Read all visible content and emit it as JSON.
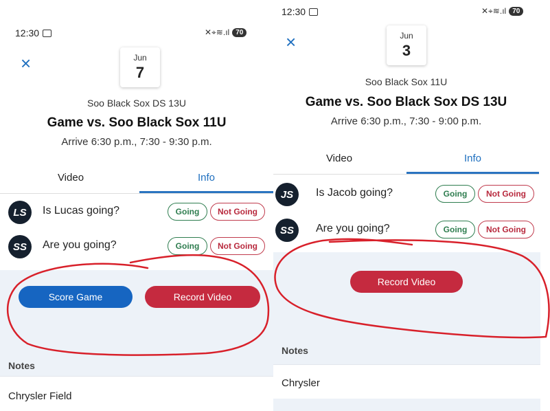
{
  "left": {
    "status": {
      "time": "12:30",
      "battery": "70",
      "icons": "✕⌖≋.ıl"
    },
    "close_glyph": "×",
    "date": {
      "month": "Jun",
      "day": "7"
    },
    "event": {
      "team": "Soo Black Sox DS 13U",
      "title": "Game vs. Soo Black Sox 11U",
      "time": "Arrive 6:30 p.m., 7:30 - 9:30 p.m."
    },
    "tabs": {
      "video": "Video",
      "info": "Info"
    },
    "rsvp": [
      {
        "initials": "LS",
        "question": "Is Lucas going?",
        "going": "Going",
        "not_going": "Not Going"
      },
      {
        "initials": "SS",
        "question": "Are you going?",
        "going": "Going",
        "not_going": "Not Going"
      }
    ],
    "buttons": {
      "score": "Score Game",
      "record": "Record Video"
    },
    "notes": {
      "label": "Notes",
      "text": "Chrysler Field"
    }
  },
  "right": {
    "status": {
      "time": "12:30",
      "battery": "70",
      "icons": "✕⌖≋.ıl"
    },
    "close_glyph": "×",
    "date": {
      "month": "Jun",
      "day": "3"
    },
    "event": {
      "team": "Soo Black Sox 11U",
      "title": "Game vs. Soo Black Sox DS 13U",
      "time": "Arrive 6:30 p.m., 7:30 - 9:00 p.m."
    },
    "tabs": {
      "video": "Video",
      "info": "Info"
    },
    "rsvp": [
      {
        "initials": "JS",
        "question": "Is Jacob going?",
        "going": "Going",
        "not_going": "Not Going"
      },
      {
        "initials": "SS",
        "question": "Are you going?",
        "going": "Going",
        "not_going": "Not Going"
      }
    ],
    "buttons": {
      "record": "Record Video"
    },
    "notes": {
      "label": "Notes",
      "text": "Chrysler"
    }
  },
  "colors": {
    "accent_blue": "#1e6fbf",
    "score_button": "#1665c1",
    "record_button": "#c52a3f",
    "going": "#2e7d4f",
    "not_going": "#b8293d",
    "annotation": "#d8202a",
    "avatar": "#15202e",
    "panel_bg": "#edf2f8"
  }
}
